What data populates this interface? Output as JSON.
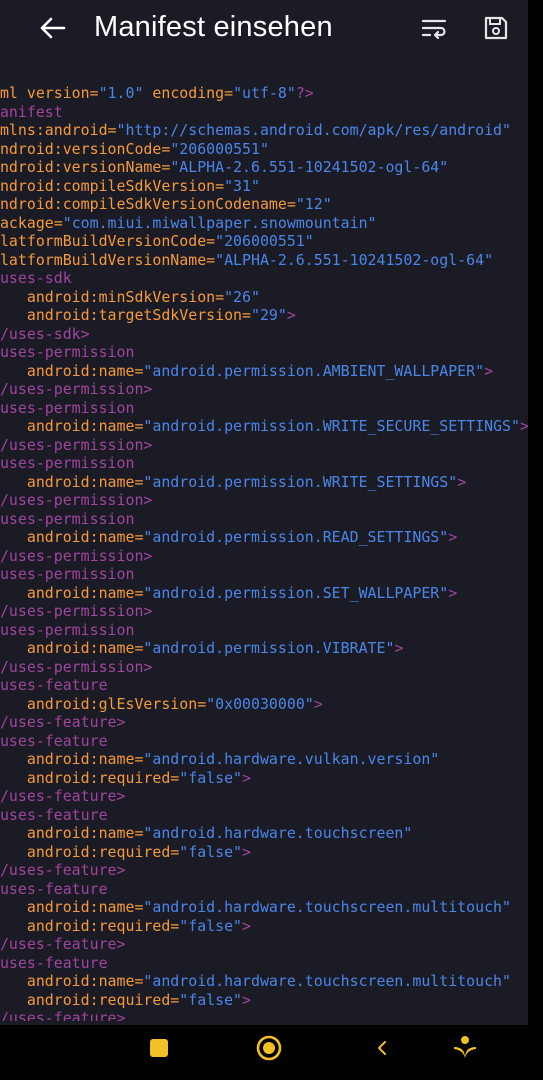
{
  "toolbar": {
    "title": "Manifest einsehen",
    "back_icon": "arrow-back-icon",
    "wrap_icon": "wrap-text-icon",
    "save_icon": "save-icon"
  },
  "code_lines": [
    [
      [
        "attr",
        "xml version="
      ],
      [
        "val",
        "\"1.0\""
      ],
      [
        "attr",
        " encoding="
      ],
      [
        "val",
        "\"utf-8\""
      ],
      [
        "tag",
        "?>"
      ]
    ],
    [
      [
        "tag",
        "manifest"
      ]
    ],
    [
      [
        "attr",
        "xmlns:android="
      ],
      [
        "val",
        "\"http://schemas.android.com/apk/res/android\""
      ]
    ],
    [
      [
        "attr",
        "android:versionCode="
      ],
      [
        "val",
        "\"206000551\""
      ]
    ],
    [
      [
        "attr",
        "android:versionName="
      ],
      [
        "val",
        "\"ALPHA-2.6.551-10241502-ogl-64\""
      ]
    ],
    [
      [
        "attr",
        "android:compileSdkVersion="
      ],
      [
        "val",
        "\"31\""
      ]
    ],
    [
      [
        "attr",
        "android:compileSdkVersionCodename="
      ],
      [
        "val",
        "\"12\""
      ]
    ],
    [
      [
        "attr",
        "package="
      ],
      [
        "val",
        "\"com.miui.miwallpaper.snowmountain\""
      ]
    ],
    [
      [
        "attr",
        "platformBuildVersionCode="
      ],
      [
        "val",
        "\"206000551\""
      ]
    ],
    [
      [
        "attr",
        "platformBuildVersionName="
      ],
      [
        "val",
        "\"ALPHA-2.6.551-10241502-ogl-64\""
      ]
    ],
    [
      [
        "tag",
        "<uses-sdk"
      ]
    ],
    [
      [
        "attr",
        "    android:minSdkVersion="
      ],
      [
        "val",
        "\"26\""
      ]
    ],
    [
      [
        "attr",
        "    android:targetSdkVersion="
      ],
      [
        "val",
        "\"29\""
      ],
      [
        "tag",
        ">"
      ]
    ],
    [
      [
        "tag",
        "</uses-sdk>"
      ]
    ],
    [
      [
        "tag",
        "<uses-permission"
      ]
    ],
    [
      [
        "attr",
        "    android:name="
      ],
      [
        "val",
        "\"android.permission.AMBIENT_WALLPAPER\""
      ],
      [
        "tag",
        ">"
      ]
    ],
    [
      [
        "tag",
        "</uses-permission>"
      ]
    ],
    [
      [
        "tag",
        "<uses-permission"
      ]
    ],
    [
      [
        "attr",
        "    android:name="
      ],
      [
        "val",
        "\"android.permission.WRITE_SECURE_SETTINGS\""
      ],
      [
        "tag",
        ">"
      ]
    ],
    [
      [
        "tag",
        "</uses-permission>"
      ]
    ],
    [
      [
        "tag",
        "<uses-permission"
      ]
    ],
    [
      [
        "attr",
        "    android:name="
      ],
      [
        "val",
        "\"android.permission.WRITE_SETTINGS\""
      ],
      [
        "tag",
        ">"
      ]
    ],
    [
      [
        "tag",
        "</uses-permission>"
      ]
    ],
    [
      [
        "tag",
        "<uses-permission"
      ]
    ],
    [
      [
        "attr",
        "    android:name="
      ],
      [
        "val",
        "\"android.permission.READ_SETTINGS\""
      ],
      [
        "tag",
        ">"
      ]
    ],
    [
      [
        "tag",
        "</uses-permission>"
      ]
    ],
    [
      [
        "tag",
        "<uses-permission"
      ]
    ],
    [
      [
        "attr",
        "    android:name="
      ],
      [
        "val",
        "\"android.permission.SET_WALLPAPER\""
      ],
      [
        "tag",
        ">"
      ]
    ],
    [
      [
        "tag",
        "</uses-permission>"
      ]
    ],
    [
      [
        "tag",
        "<uses-permission"
      ]
    ],
    [
      [
        "attr",
        "    android:name="
      ],
      [
        "val",
        "\"android.permission.VIBRATE\""
      ],
      [
        "tag",
        ">"
      ]
    ],
    [
      [
        "tag",
        "</uses-permission>"
      ]
    ],
    [
      [
        "tag",
        "<uses-feature"
      ]
    ],
    [
      [
        "attr",
        "    android:glEsVersion="
      ],
      [
        "val",
        "\"0x00030000\""
      ],
      [
        "tag",
        ">"
      ]
    ],
    [
      [
        "tag",
        "</uses-feature>"
      ]
    ],
    [
      [
        "tag",
        "<uses-feature"
      ]
    ],
    [
      [
        "attr",
        "    android:name="
      ],
      [
        "val",
        "\"android.hardware.vulkan.version\""
      ]
    ],
    [
      [
        "attr",
        "    android:required="
      ],
      [
        "val",
        "\"false\""
      ],
      [
        "tag",
        ">"
      ]
    ],
    [
      [
        "tag",
        "</uses-feature>"
      ]
    ],
    [
      [
        "tag",
        "<uses-feature"
      ]
    ],
    [
      [
        "attr",
        "    android:name="
      ],
      [
        "val",
        "\"android.hardware.touchscreen\""
      ]
    ],
    [
      [
        "attr",
        "    android:required="
      ],
      [
        "val",
        "\"false\""
      ],
      [
        "tag",
        ">"
      ]
    ],
    [
      [
        "tag",
        "</uses-feature>"
      ]
    ],
    [
      [
        "tag",
        "<uses-feature"
      ]
    ],
    [
      [
        "attr",
        "    android:name="
      ],
      [
        "val",
        "\"android.hardware.touchscreen.multitouch\""
      ]
    ],
    [
      [
        "attr",
        "    android:required="
      ],
      [
        "val",
        "\"false\""
      ],
      [
        "tag",
        ">"
      ]
    ],
    [
      [
        "tag",
        "</uses-feature>"
      ]
    ],
    [
      [
        "tag",
        "<uses-feature"
      ]
    ],
    [
      [
        "attr",
        "    android:name="
      ],
      [
        "val",
        "\"android.hardware.touchscreen.multitouch\""
      ]
    ],
    [
      [
        "attr",
        "    android:required="
      ],
      [
        "val",
        "\"false\""
      ],
      [
        "tag",
        ">"
      ]
    ],
    [
      [
        "tag",
        "</uses-feature>"
      ]
    ]
  ],
  "colors": {
    "tag": "#a0459e",
    "attr": "#f59a3a",
    "value": "#4a86e8",
    "background": "#1b1b25",
    "nav_accent": "#f0c024"
  },
  "navbar": {
    "recents_icon": "square-recents-icon",
    "home_icon": "circle-home-icon",
    "back_icon": "chevron-back-icon",
    "assist_icon": "assistant-icon"
  }
}
